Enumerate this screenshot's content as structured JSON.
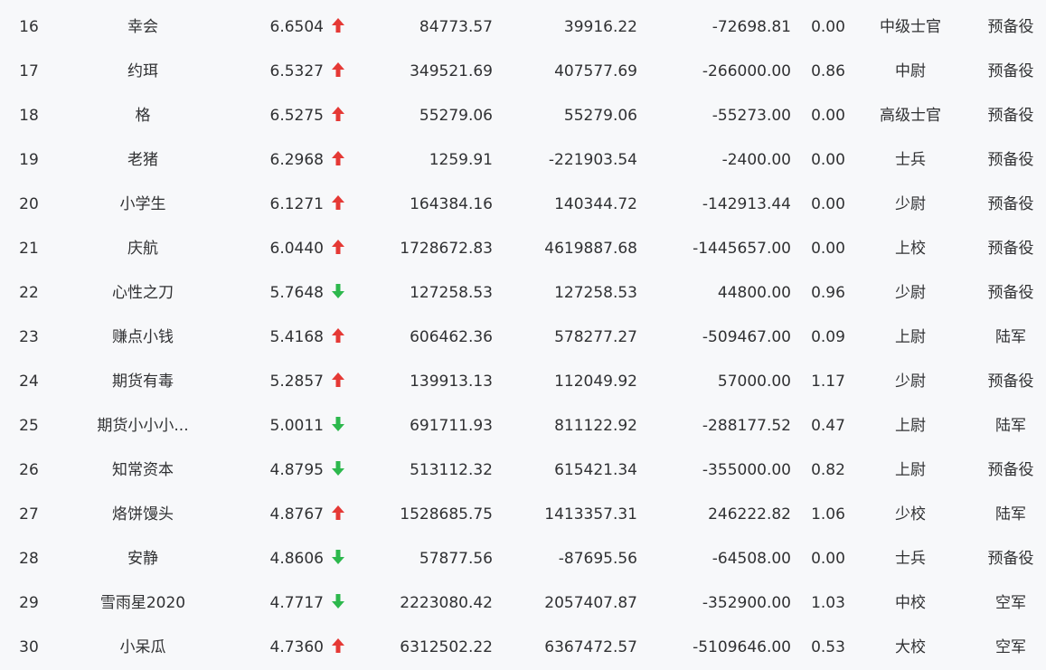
{
  "colors": {
    "up": "#e53935",
    "down": "#2db84d",
    "text": "#303133",
    "background": "#f7f8fa"
  },
  "rows": [
    {
      "rank": "16",
      "name": "幸会",
      "score": "6.6504",
      "trend": "up",
      "v1": "84773.57",
      "v2": "39916.22",
      "v3": "-72698.81",
      "v4": "0.00",
      "title": "中级士官",
      "branch": "预备役"
    },
    {
      "rank": "17",
      "name": "约珥",
      "score": "6.5327",
      "trend": "up",
      "v1": "349521.69",
      "v2": "407577.69",
      "v3": "-266000.00",
      "v4": "0.86",
      "title": "中尉",
      "branch": "预备役"
    },
    {
      "rank": "18",
      "name": "格",
      "score": "6.5275",
      "trend": "up",
      "v1": "55279.06",
      "v2": "55279.06",
      "v3": "-55273.00",
      "v4": "0.00",
      "title": "高级士官",
      "branch": "预备役"
    },
    {
      "rank": "19",
      "name": "老猪",
      "score": "6.2968",
      "trend": "up",
      "v1": "1259.91",
      "v2": "-221903.54",
      "v3": "-2400.00",
      "v4": "0.00",
      "title": "士兵",
      "branch": "预备役"
    },
    {
      "rank": "20",
      "name": "小学生",
      "score": "6.1271",
      "trend": "up",
      "v1": "164384.16",
      "v2": "140344.72",
      "v3": "-142913.44",
      "v4": "0.00",
      "title": "少尉",
      "branch": "预备役"
    },
    {
      "rank": "21",
      "name": "庆航",
      "score": "6.0440",
      "trend": "up",
      "v1": "1728672.83",
      "v2": "4619887.68",
      "v3": "-1445657.00",
      "v4": "0.00",
      "title": "上校",
      "branch": "预备役"
    },
    {
      "rank": "22",
      "name": "心性之刀",
      "score": "5.7648",
      "trend": "down",
      "v1": "127258.53",
      "v2": "127258.53",
      "v3": "44800.00",
      "v4": "0.96",
      "title": "少尉",
      "branch": "预备役"
    },
    {
      "rank": "23",
      "name": "赚点小钱",
      "score": "5.4168",
      "trend": "up",
      "v1": "606462.36",
      "v2": "578277.27",
      "v3": "-509467.00",
      "v4": "0.09",
      "title": "上尉",
      "branch": "陆军"
    },
    {
      "rank": "24",
      "name": "期货有毒",
      "score": "5.2857",
      "trend": "up",
      "v1": "139913.13",
      "v2": "112049.92",
      "v3": "57000.00",
      "v4": "1.17",
      "title": "少尉",
      "branch": "预备役"
    },
    {
      "rank": "25",
      "name": "期货小小小...",
      "score": "5.0011",
      "trend": "down",
      "v1": "691711.93",
      "v2": "811122.92",
      "v3": "-288177.52",
      "v4": "0.47",
      "title": "上尉",
      "branch": "陆军"
    },
    {
      "rank": "26",
      "name": "知常资本",
      "score": "4.8795",
      "trend": "down",
      "v1": "513112.32",
      "v2": "615421.34",
      "v3": "-355000.00",
      "v4": "0.82",
      "title": "上尉",
      "branch": "预备役"
    },
    {
      "rank": "27",
      "name": "烙饼馒头",
      "score": "4.8767",
      "trend": "up",
      "v1": "1528685.75",
      "v2": "1413357.31",
      "v3": "246222.82",
      "v4": "1.06",
      "title": "少校",
      "branch": "陆军"
    },
    {
      "rank": "28",
      "name": "安静",
      "score": "4.8606",
      "trend": "down",
      "v1": "57877.56",
      "v2": "-87695.56",
      "v3": "-64508.00",
      "v4": "0.00",
      "title": "士兵",
      "branch": "预备役"
    },
    {
      "rank": "29",
      "name": "雪雨星2020",
      "score": "4.7717",
      "trend": "down",
      "v1": "2223080.42",
      "v2": "2057407.87",
      "v3": "-352900.00",
      "v4": "1.03",
      "title": "中校",
      "branch": "空军"
    },
    {
      "rank": "30",
      "name": "小呆瓜",
      "score": "4.7360",
      "trend": "up",
      "v1": "6312502.22",
      "v2": "6367472.57",
      "v3": "-5109646.00",
      "v4": "0.53",
      "title": "大校",
      "branch": "空军"
    }
  ]
}
